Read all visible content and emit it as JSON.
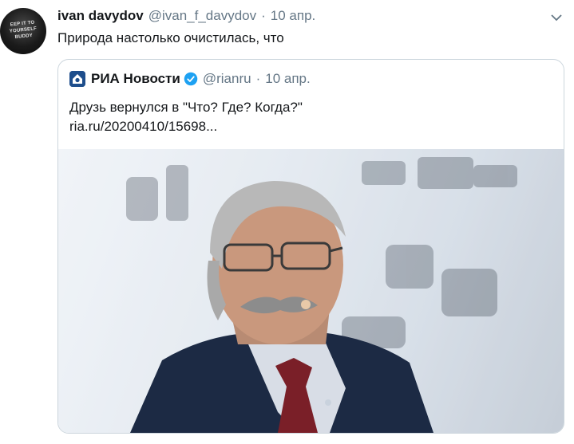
{
  "tweet": {
    "author_name": "ivan davydov",
    "author_handle": "@ivan_f_davydov",
    "separator": "·",
    "date": "10 апр.",
    "text": "Природа настолько очистилась, что",
    "avatar_text": "EEP IT TO YOURSELF BUDDY"
  },
  "quoted": {
    "author_name": "РИА Новости",
    "author_handle": "@rianru",
    "separator": "·",
    "date": "10 апр.",
    "text": "Друзь вернулся в \"Что? Где? Когда?\"",
    "link": "ria.ru/20200410/15698...",
    "verified": true
  },
  "icons": {
    "caret": "chevron-down-icon",
    "verified": "verified-badge-icon",
    "logo": "ria-logo-icon"
  },
  "colors": {
    "text": "#14171a",
    "secondary": "#657786",
    "border": "#ccd6dd",
    "verified": "#1da1f2",
    "ria_logo": "#1e4e8c"
  }
}
